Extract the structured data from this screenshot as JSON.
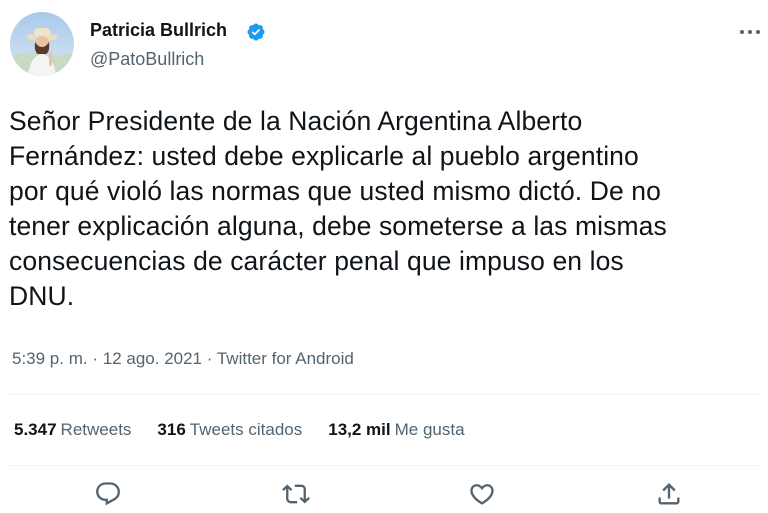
{
  "author": {
    "name": "Patricia Bullrich",
    "handle": "@PatoBullrich",
    "verified": true
  },
  "tweet": {
    "lines": [
      "Señor Presidente de la Nación Argentina Alberto",
      "Fernández: usted debe explicarle al pueblo argentino",
      "por qué violó las normas que usted mismo dictó. De no",
      "tener explicación alguna, debe someterse a las mismas",
      "consecuencias de carácter penal que impuso en los",
      "DNU."
    ]
  },
  "meta": {
    "time": "5:39 p. m.",
    "separator": "·",
    "date": "12 ago. 2021",
    "source": "Twitter for Android"
  },
  "stats": {
    "retweets_count": "5.347",
    "retweets_label": "Retweets",
    "quotes_count": "316",
    "quotes_label": "Tweets citados",
    "likes_count": "13,2 mil",
    "likes_label": "Me gusta"
  },
  "actions": {
    "reply_icon": "reply-icon",
    "retweet_icon": "retweet-icon",
    "like_icon": "heart-icon",
    "share_icon": "share-icon"
  },
  "colors": {
    "text": "#0f1419",
    "secondary": "#536471",
    "verified": "#1d9bf0",
    "divider": "#eff3f4"
  }
}
